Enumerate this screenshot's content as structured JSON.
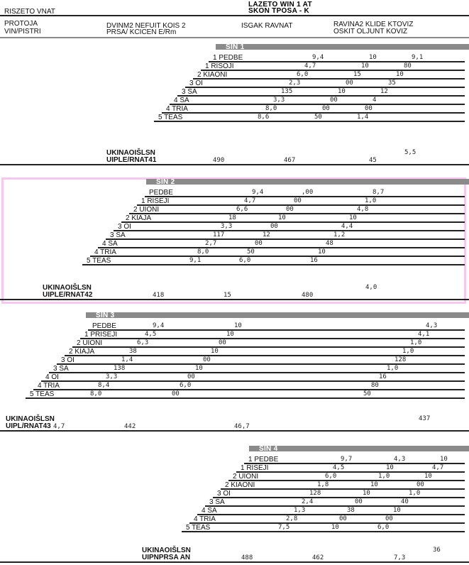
{
  "document": {
    "title_line1": "LAZETO WIN 1 AT",
    "title_line2": "SKON TPOSA - K",
    "header_left_1": "RISZETO VNAT",
    "header_left_2": "PROTOJA",
    "header_left_3": "VIN/PISTRI",
    "header_mid_1": "DVINM2 NEFUIT KOIS 2",
    "header_mid_2": "PRSA/ KCICEN E/Rm",
    "header_right_1": "ISGAK  RAVNAT",
    "header_right_2": "RAVINA2 KLIDE KTOVIZ",
    "header_right_3": "OSKIT  OLJUNT  KOVIZ"
  },
  "blocks": [
    {
      "id": "block-1",
      "section_label": "SIN 1",
      "rows": [
        {
          "label": "1 PEDBE",
          "a": "9,4",
          "b": "10",
          "c": "9,1"
        },
        {
          "label": "1 RISOJI",
          "a": "4,7",
          "b": "10",
          "c": "80"
        },
        {
          "label": "2 KIAONI",
          "a": "6,0",
          "b": "15",
          "c": "10"
        },
        {
          "label": "3 OI",
          "a": "2,3",
          "b": "00",
          "c": "35"
        },
        {
          "label": "3 SA",
          "a": "135",
          "b": "10",
          "c": "12"
        },
        {
          "label": "4 SA",
          "a": "3,3",
          "b": "00",
          "c": "4"
        },
        {
          "label": "4 TRIA",
          "a": "8,0",
          "b": "00",
          "c": "00"
        },
        {
          "label": "5 TEAS",
          "a": "8,6",
          "b": "50",
          "c": "1,4"
        }
      ],
      "total_label_1": "UKINAOIŠLSN",
      "total_label_2": "UIPLE/RNAT41",
      "total_a": "490",
      "total_b": "467",
      "total_c": "45",
      "total_d": "5,5"
    },
    {
      "id": "block-2",
      "section_label": "SIN 2",
      "rows": [
        {
          "label": "PEDBE",
          "a": "9,4",
          "b": ",00",
          "c": "8,7"
        },
        {
          "label": "1 RISEJI",
          "a": "4,7",
          "b": "00",
          "c": "1,0"
        },
        {
          "label": "2 UIONI",
          "a": "6,6",
          "b": "00",
          "c": "4,8"
        },
        {
          "label": "2 KIAJA",
          "a": "18",
          "b": "10",
          "c": "10"
        },
        {
          "label": "3 OI",
          "a": "3,3",
          "b": "00",
          "c": "4,4"
        },
        {
          "label": "3 SA",
          "a": "117",
          "b": "12",
          "c": "1,2"
        },
        {
          "label": "4 SA",
          "a": "2,7",
          "b": "00",
          "c": "48"
        },
        {
          "label": "4 TRIA",
          "a": "8,0",
          "b": "50",
          "c": "10"
        },
        {
          "label": "5 TEAS",
          "a": "9,1",
          "b": "6,0",
          "c": "16"
        }
      ],
      "total_label_1": "UKINAOIŠLSN",
      "total_label_2": "UIPLE/RNAT42",
      "total_a": "418",
      "total_b": "15",
      "total_c": "480",
      "total_d": "4,0"
    },
    {
      "id": "block-3",
      "section_label": "SIN 3",
      "rows": [
        {
          "label": "PEDBE",
          "a": "9,4",
          "b": "10",
          "c": "4,3"
        },
        {
          "label": "1 PRISEJI",
          "a": "4,5",
          "b": "10",
          "c": "4,1"
        },
        {
          "label": "2 UIONI",
          "a": "6,3",
          "b": "00",
          "c": "1,0"
        },
        {
          "label": "2 KIAJA",
          "a": "38",
          "b": "10",
          "c": "1,0"
        },
        {
          "label": "3 OI",
          "a": "1,4",
          "b": "00",
          "c": "128"
        },
        {
          "label": "3 SA",
          "a": "138",
          "b": "10",
          "c": "1,0"
        },
        {
          "label": "4 OI",
          "a": "3,3",
          "b": "00",
          "c": "16"
        },
        {
          "label": "4 TRIA",
          "a": "8,4",
          "b": "6,0",
          "c": "80"
        },
        {
          "label": "5 TEAS",
          "a": "8,0",
          "b": "00",
          "c": "50"
        }
      ],
      "total_label_1": "UKINAOIŠLSN",
      "total_label_2": "UIPL/RNAT43",
      "total_a": "4,7",
      "total_b": "442",
      "total_c": "46,7",
      "total_d": "437"
    },
    {
      "id": "block-4",
      "section_label": "SIN 4",
      "rows": [
        {
          "label": "1 PEDBE",
          "a": "9,7",
          "b": "4,3",
          "c": "10"
        },
        {
          "label": "1 RISEJI",
          "a": "4,5",
          "b": "10",
          "c": "4,7"
        },
        {
          "label": "2 UIONI",
          "a": "6,0",
          "b": "1,0",
          "c": "10"
        },
        {
          "label": "2 KIAONI",
          "a": "1,8",
          "b": "10",
          "c": "00"
        },
        {
          "label": "3 OI",
          "a": "128",
          "b": "10",
          "c": "1,0"
        },
        {
          "label": "3 SA",
          "a": "2,4",
          "b": "00",
          "c": "40"
        },
        {
          "label": "4 SA",
          "a": "1,3",
          "b": "38",
          "c": "10"
        },
        {
          "label": "4 TRIA",
          "a": "2,8",
          "b": "00",
          "c": "00"
        },
        {
          "label": "5 TEAS",
          "a": "7,5",
          "b": "10",
          "c": "6,0"
        }
      ],
      "total_label_1": "UKINAOIŠLSN",
      "total_label_2": "UIPNPRSA AN",
      "total_a": "488",
      "total_b": "462",
      "total_c": "7,3",
      "total_d": "36"
    }
  ]
}
